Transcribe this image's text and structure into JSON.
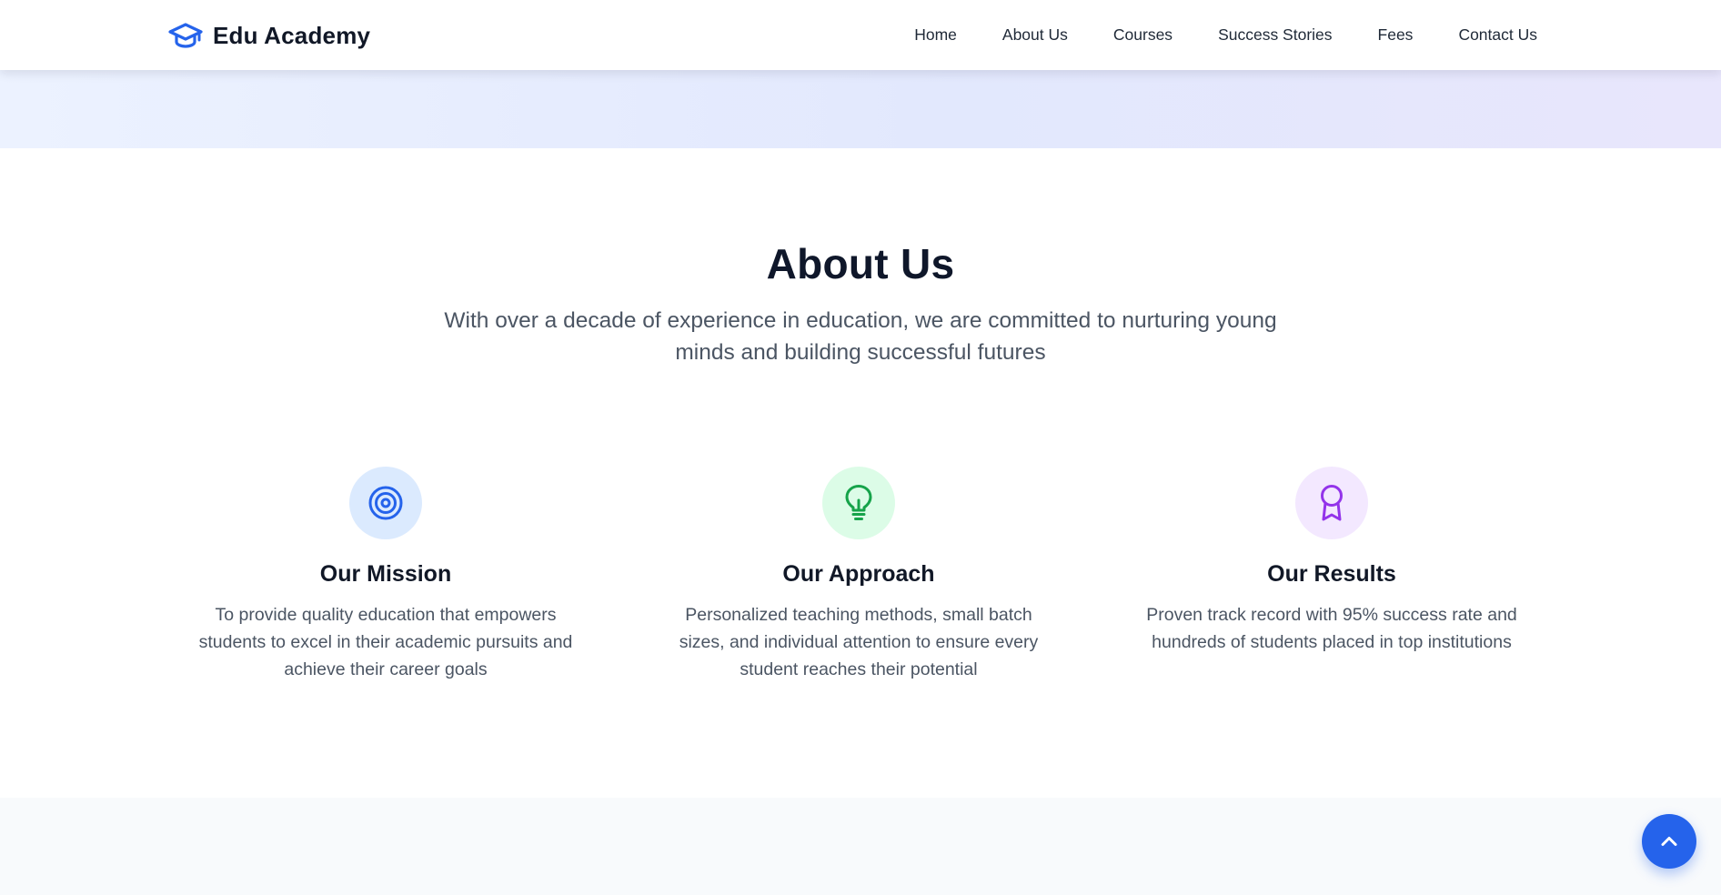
{
  "navbar": {
    "brand": {
      "name": "Edu Academy",
      "icon": "graduation-cap-icon",
      "icon_color": "#2563eb"
    },
    "links": [
      {
        "label": "Home"
      },
      {
        "label": "About Us"
      },
      {
        "label": "Courses"
      },
      {
        "label": "Success Stories"
      },
      {
        "label": "Fees"
      },
      {
        "label": "Contact Us"
      }
    ]
  },
  "about": {
    "title": "About Us",
    "subtitle": "With over a decade of experience in education, we are committed to nurturing young minds and building successful futures",
    "cards": [
      {
        "title": "Our Mission",
        "text": "To provide quality education that empowers students to excel in their academic pursuits and achieve their career goals",
        "icon": "target-icon",
        "icon_color": "#2563eb",
        "icon_bg": "#dbeafe"
      },
      {
        "title": "Our Approach",
        "text": "Personalized teaching methods, small batch sizes, and individual attention to ensure every student reaches their potential",
        "icon": "lightbulb-icon",
        "icon_color": "#16a34a",
        "icon_bg": "#dcfce7"
      },
      {
        "title": "Our Results",
        "text": "Proven track record with 95% success rate and hundreds of students placed in top institutions",
        "icon": "award-icon",
        "icon_color": "#9333ea",
        "icon_bg": "#f3e8ff"
      }
    ]
  },
  "scroll_top": {
    "icon": "chevron-up-icon",
    "color": "#2563eb"
  }
}
